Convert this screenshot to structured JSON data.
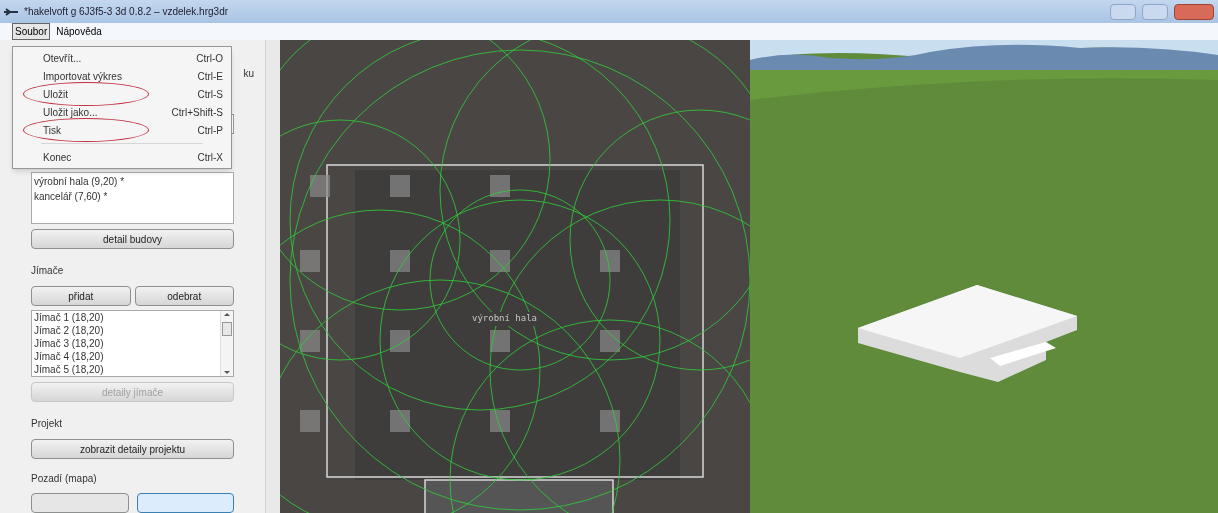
{
  "window": {
    "title": "*hakelvoft g 6J3f5-3 3d 0.8.2 – vzdelek.hrg3dr"
  },
  "menu_bar": [
    {
      "label": "Soubor",
      "selected": true
    },
    {
      "label": "Nápověda",
      "selected": false
    }
  ],
  "menu": {
    "items": [
      {
        "kind": "item",
        "label": "Otevřít...",
        "shortcut": "Ctrl-O",
        "circled": false
      },
      {
        "kind": "item",
        "label": "Importovat výkres",
        "shortcut": "Ctrl-E",
        "circled": false
      },
      {
        "kind": "item",
        "label": "Uložit",
        "shortcut": "Ctrl-S",
        "circled": true
      },
      {
        "kind": "item",
        "label": "Uložit jako...",
        "shortcut": "Ctrl+Shift-S",
        "circled": false
      },
      {
        "kind": "item",
        "label": "Tisk",
        "shortcut": "Ctrl-P",
        "circled": true
      },
      {
        "kind": "separator"
      },
      {
        "kind": "item",
        "label": "Konec",
        "shortcut": "Ctrl-X",
        "circled": false
      }
    ]
  },
  "left_panel": {
    "partial_label": "ku",
    "buildings": [
      "výrobní hala (9,20) *",
      "kancelář (7,60) *"
    ],
    "building_detail_button": "detail budovy",
    "rods_heading": "Jímače",
    "add_button": "přidat",
    "remove_button": "odebrat",
    "rods": [
      "Jímač 1 (18,20)",
      "Jímač 2 (18,20)",
      "Jímač 3 (18,20)",
      "Jímač 4 (18,20)",
      "Jímač 5 (18,20)"
    ],
    "rod_details_button": {
      "label": "detaily jímače",
      "disabled": true
    },
    "project_heading": "Projekt",
    "project_button": "zobrazit detaily projektu",
    "background_heading": "Pozadí (mapa)",
    "background_buttons": [
      {
        "selected": false
      },
      {
        "selected": true
      }
    ]
  },
  "plan": {
    "building_label": "výrobní hala"
  }
}
